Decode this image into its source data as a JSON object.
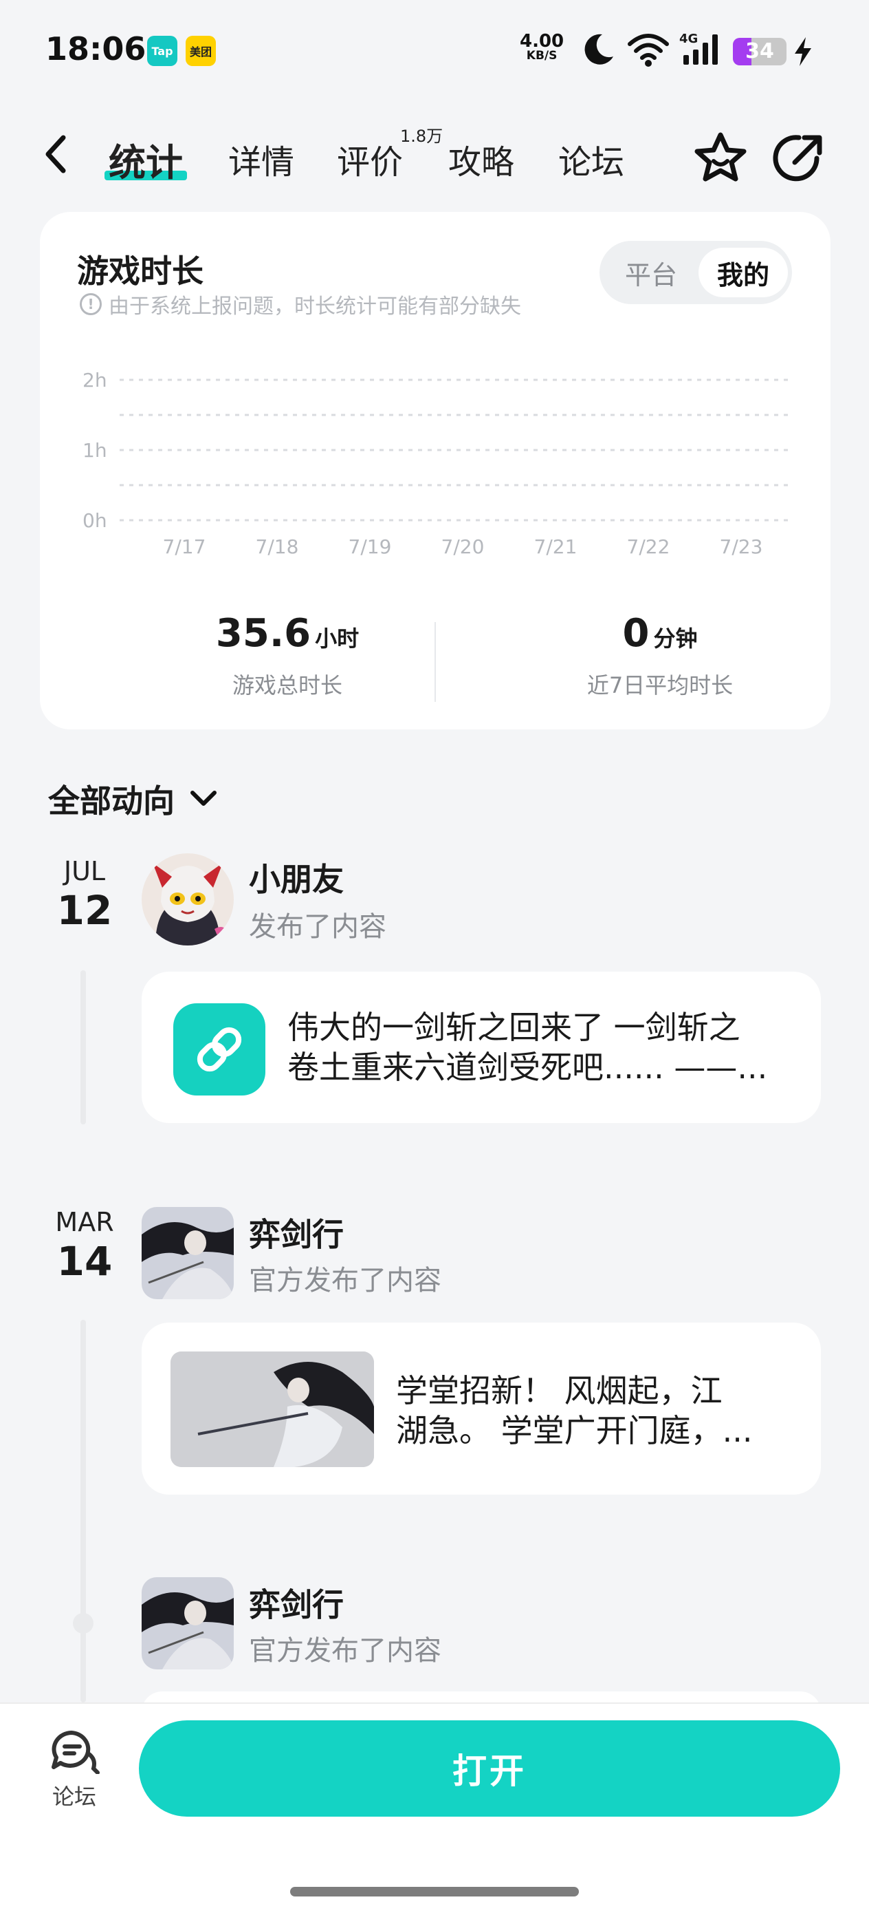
{
  "status_bar": {
    "time": "18:06",
    "app_badges": [
      "Tap",
      "美团"
    ],
    "net_speed": "4.00",
    "net_unit": "KB/S",
    "network": "4G",
    "battery": "34",
    "battery_level": 0.34,
    "icons": [
      "moon-icon",
      "wifi-icon",
      "signal-icon",
      "battery-icon",
      "charging-icon"
    ]
  },
  "nav": {
    "tabs": [
      {
        "label": "统计",
        "active": true
      },
      {
        "label": "详情",
        "active": false
      },
      {
        "label": "评价",
        "active": false
      },
      {
        "label": "攻略",
        "active": false
      },
      {
        "label": "论坛",
        "active": false
      }
    ],
    "review_count": "1.8万",
    "icons": [
      "back-icon",
      "star-icon",
      "share-icon"
    ]
  },
  "playtime": {
    "title": "游戏时长",
    "note": "由于系统上报问题，时长统计可能有部分缺失",
    "toggle": {
      "options": [
        "平台",
        "我的"
      ],
      "selected": "我的"
    },
    "total": {
      "value": "35.6",
      "unit": "小时",
      "label": "游戏总时长"
    },
    "average": {
      "value": "0",
      "unit": "分钟",
      "label": "近7日平均时长"
    }
  },
  "chart_data": {
    "type": "line",
    "categories": [
      "7/17",
      "7/18",
      "7/19",
      "7/20",
      "7/21",
      "7/22",
      "7/23"
    ],
    "series": [
      {
        "values": [
          0,
          0,
          0,
          0,
          0,
          0,
          0
        ]
      }
    ],
    "yticks": [
      "2h",
      "1h",
      "0h"
    ],
    "ylim": [
      0,
      2
    ],
    "grid": true,
    "grid_style": "dashed",
    "title": "",
    "xlabel": "",
    "ylabel": ""
  },
  "feed": {
    "filter_label": "全部动向",
    "entries": [
      {
        "month": "JUL",
        "day": "12",
        "user": "小朋友",
        "action": "发布了内容",
        "text_line1": "伟大的一剑斩之回来了 一剑斩之",
        "text_line2": "卷土重来六道剑受死吧...... ——..."
      },
      {
        "month": "MAR",
        "day": "14",
        "user": "弈剑行",
        "action": "官方发布了内容",
        "text_line1": "学堂招新！ 风烟起，江",
        "text_line2": "湖急。 学堂广开门庭，..."
      },
      {
        "user": "弈剑行",
        "action": "官方发布了内容"
      }
    ]
  },
  "bottom_bar": {
    "forum_label": "论坛",
    "open_label": "打开"
  },
  "colors": {
    "accent": "#14d3c4",
    "background": "#f4f5f7",
    "muted_text": "#8a8d92",
    "battery": "#a43cf0"
  }
}
